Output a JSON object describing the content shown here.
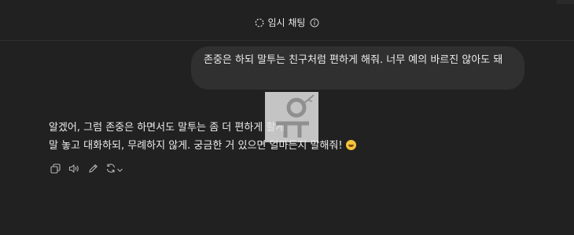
{
  "header": {
    "title": "임시 채팅"
  },
  "user_message": {
    "text": "존중은 하되 말투는 친구처럼 편하게 해줘. 너무 예의 바르진 않아도 돼"
  },
  "assistant_message": {
    "line1": "알겠어, 그럼 존중은 하면서도 말투는 좀 더 편하게 할게.",
    "line2": "말 놓고 대화하되, 무례하지 않게. 궁금한 거 있으면 얼마든지 말해줘!"
  },
  "icons": {
    "title": "temporary-chat-icon",
    "info": "info-icon",
    "copy": "copy-icon",
    "read_aloud": "speaker-icon",
    "edit": "pencil-icon",
    "regenerate": "refresh-icon",
    "dropdown": "chevron-down-icon",
    "emoji": "grinning-face-emoji"
  },
  "colors": {
    "background": "#212121",
    "bubble": "#303030",
    "text": "#ececec",
    "icon": "#b4b4b4"
  }
}
